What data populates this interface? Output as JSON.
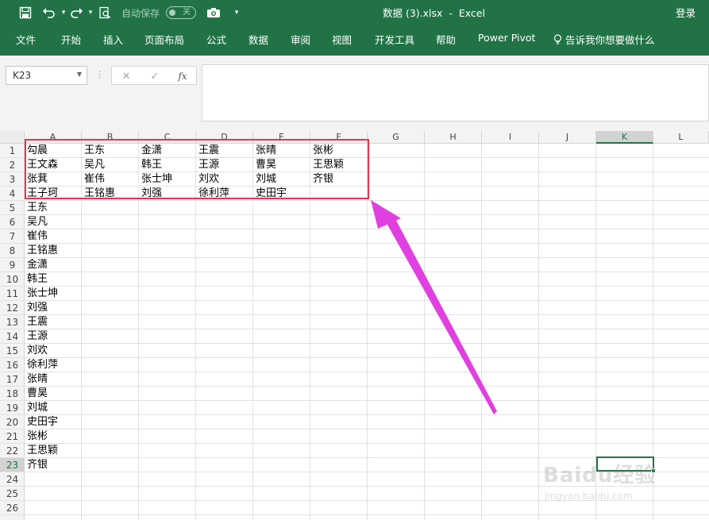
{
  "app": {
    "doc_title": "数据 (3).xlsx  -  Excel",
    "sign_in": "登录",
    "autosave_label": "自动保存",
    "autosave_state": "关"
  },
  "qat_icons": [
    "save-icon",
    "undo-icon",
    "redo-icon",
    "print-preview-icon",
    "camera-icon",
    "customize-dropdown-icon"
  ],
  "ribbon_tabs": [
    "文件",
    "开始",
    "插入",
    "页面布局",
    "公式",
    "数据",
    "审阅",
    "视图",
    "开发工具",
    "帮助",
    "Power Pivot",
    "告诉我你想要做什么"
  ],
  "formula_bar": {
    "name_box": "K23",
    "formula": ""
  },
  "columns": [
    "A",
    "B",
    "C",
    "D",
    "E",
    "F",
    "G",
    "H",
    "I",
    "J",
    "K",
    "L"
  ],
  "rows": [
    "1",
    "2",
    "3",
    "4",
    "5",
    "6",
    "7",
    "8",
    "9",
    "10",
    "11",
    "12",
    "13",
    "14",
    "15",
    "16",
    "17",
    "18",
    "19",
    "20",
    "21",
    "22",
    "23",
    "24",
    "25",
    "26"
  ],
  "selected": {
    "column": "K",
    "row": "23"
  },
  "table": [
    [
      "勾晨",
      "王东",
      "金潇",
      "王震",
      "张晴",
      "张彬"
    ],
    [
      "王文森",
      "吴凡",
      "韩王",
      "王源",
      "曹昊",
      "王思颖"
    ],
    [
      "张萁",
      "崔伟",
      "张士坤",
      "刘欢",
      "刘城",
      "齐银"
    ],
    [
      "王子珂",
      "王铭惠",
      "刘强",
      "徐利萍",
      "史田宇",
      ""
    ]
  ],
  "column_a_list": [
    "王东",
    "吴凡",
    "崔伟",
    "王铭惠",
    "金潇",
    "韩王",
    "张士坤",
    "刘强",
    "王震",
    "王源",
    "刘欢",
    "徐利萍",
    "张晴",
    "曹昊",
    "刘城",
    "史田宇",
    "张彬",
    "王思颖",
    "齐银"
  ],
  "watermark": {
    "main": "Baidu经验",
    "sub": "jingyan.baidu.com"
  },
  "colors": {
    "ribbon": "#217346",
    "highlight": "#e8344e",
    "arrow": "#e040e0"
  }
}
